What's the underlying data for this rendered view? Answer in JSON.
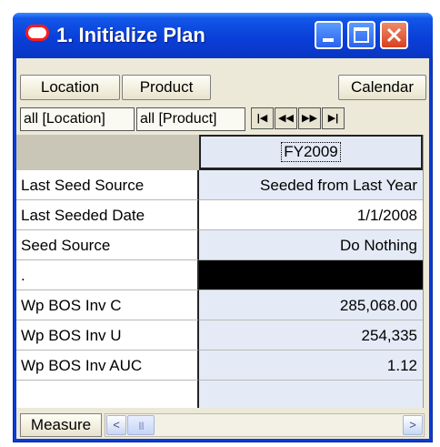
{
  "window": {
    "title": "1. Initialize Plan",
    "icon": "oracle-logo-icon"
  },
  "toolbar": {
    "location_label": "Location",
    "product_label": "Product",
    "calendar_label": "Calendar"
  },
  "positions": {
    "location_chip": "all [Location]",
    "product_chip": "all [Product]",
    "nav": {
      "first": "|◀",
      "prev": "◀◀",
      "next": "▶▶",
      "last": "▶|"
    }
  },
  "grid": {
    "column_header": "FY2009",
    "rows": [
      {
        "label": "Last Seed Source",
        "value": "Seeded from Last Year"
      },
      {
        "label": "Last Seeded Date",
        "value": "1/1/2008"
      },
      {
        "label": "Seed Source",
        "value": "Do Nothing"
      },
      {
        "label": ".",
        "value": ""
      },
      {
        "label": "Wp BOS Inv C",
        "value": "285,068.00"
      },
      {
        "label": "Wp BOS Inv U",
        "value": "254,335"
      },
      {
        "label": "Wp BOS Inv AUC",
        "value": "1.12"
      }
    ]
  },
  "footer": {
    "measure_label": "Measure",
    "scroll_left": "<",
    "scroll_right": ">",
    "thumb_grip": "||||"
  }
}
